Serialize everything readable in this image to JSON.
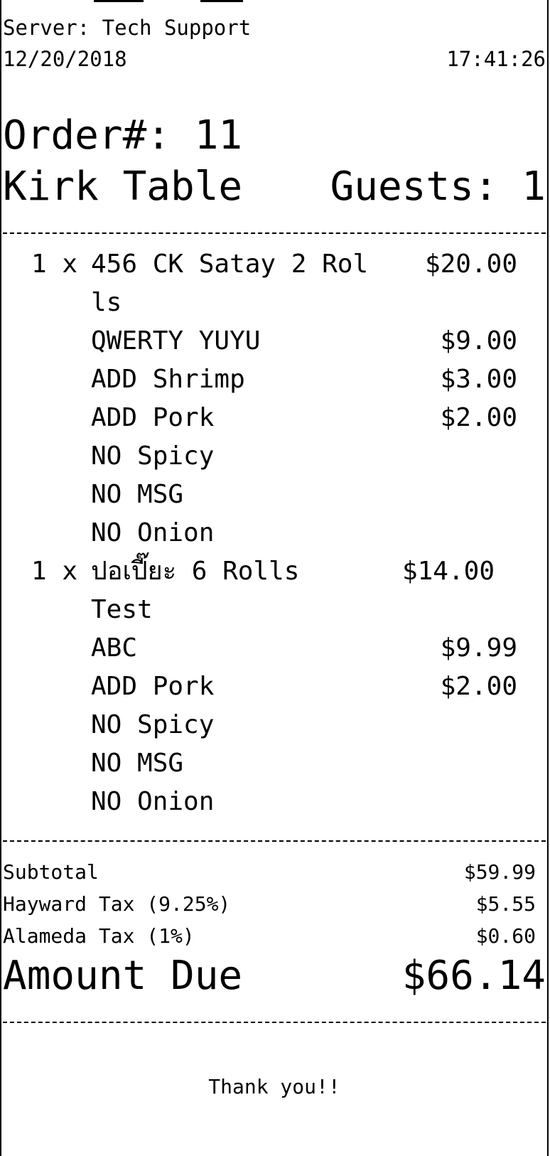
{
  "header": {
    "server": "Server: Tech Support",
    "date": "12/20/2018",
    "time": "17:41:26",
    "order": "Order#: 11",
    "table": "Kirk Table",
    "guests": "Guests: 1"
  },
  "items": [
    {
      "qty": "1 x",
      "desc": "456 CK Satay 2 Rol",
      "price": "$20.00"
    },
    {
      "qty": "",
      "desc": "ls",
      "price": ""
    },
    {
      "qty": "",
      "desc": "QWERTY YUYU",
      "price": "$9.00"
    },
    {
      "qty": "",
      "desc": "ADD Shrimp",
      "price": "$3.00"
    },
    {
      "qty": "",
      "desc": "ADD Pork",
      "price": "$2.00"
    },
    {
      "qty": "",
      "desc": "NO Spicy",
      "price": ""
    },
    {
      "qty": "",
      "desc": "NO MSG",
      "price": ""
    },
    {
      "qty": "",
      "desc": "NO Onion",
      "price": ""
    },
    {
      "qty": "1 x",
      "desc": "ปอเปี๊ยะ 6 Rolls",
      "price": "$14.00"
    },
    {
      "qty": "",
      "desc": "Test",
      "price": ""
    },
    {
      "qty": "",
      "desc": "ABC",
      "price": "$9.99"
    },
    {
      "qty": "",
      "desc": "ADD Pork",
      "price": "$2.00"
    },
    {
      "qty": "",
      "desc": "NO Spicy",
      "price": ""
    },
    {
      "qty": "",
      "desc": "NO MSG",
      "price": ""
    },
    {
      "qty": "",
      "desc": "NO Onion",
      "price": ""
    }
  ],
  "totals": {
    "subtotal_label": "Subtotal",
    "subtotal": "$59.99",
    "tax1_label": "Hayward Tax (9.25%)",
    "tax1": "$5.55",
    "tax2_label": "Alameda Tax (1%)",
    "tax2": "$0.60",
    "due_label": "Amount Due",
    "due": "$66.14"
  },
  "footer": {
    "thanks": "Thank you!!"
  }
}
